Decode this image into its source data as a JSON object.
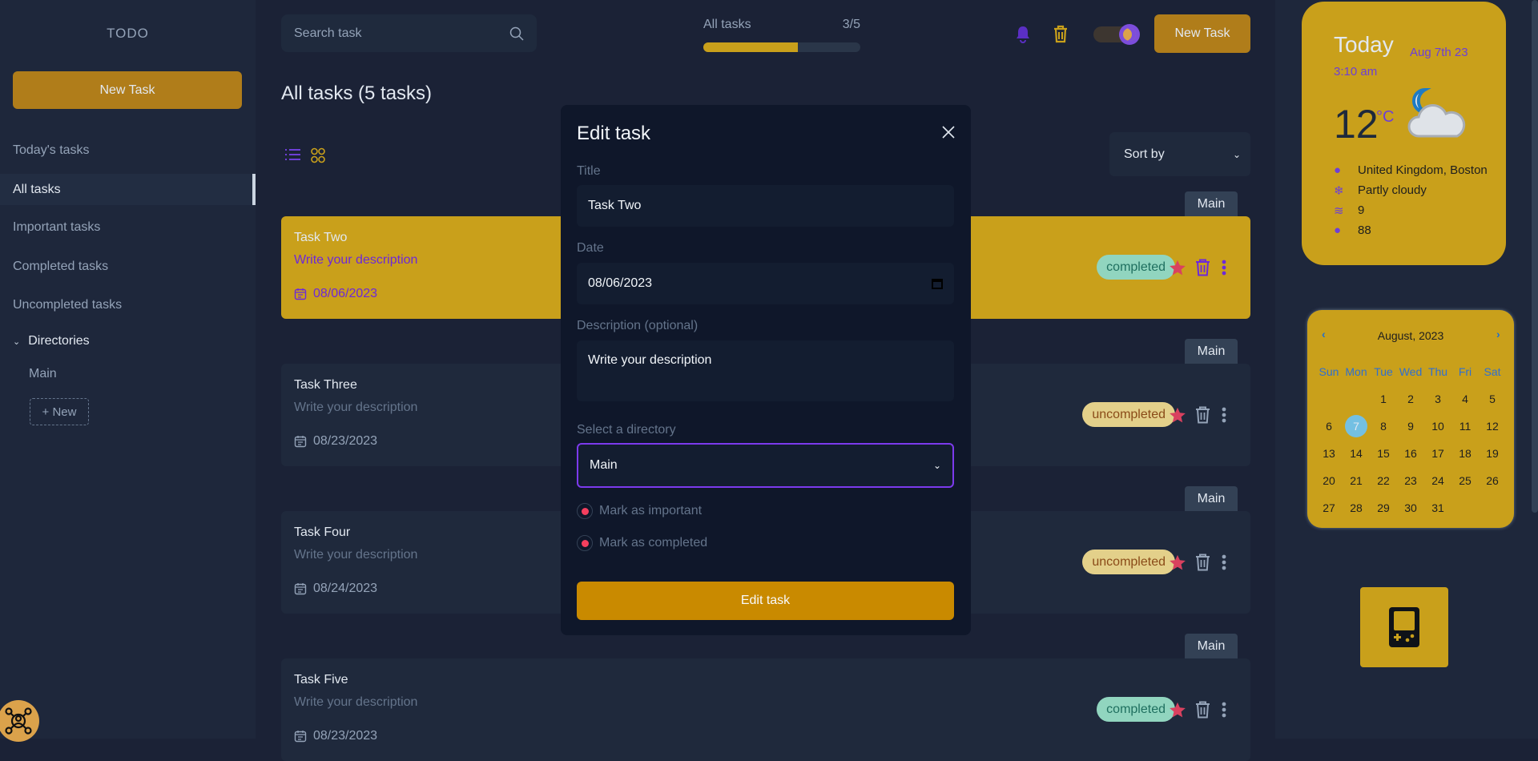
{
  "sidebar": {
    "app_title": "TODO",
    "new_task_label": "New Task",
    "items": [
      {
        "label": "Today's tasks"
      },
      {
        "label": "All tasks",
        "active": true
      },
      {
        "label": "Important tasks"
      },
      {
        "label": "Completed tasks"
      },
      {
        "label": "Uncompleted tasks"
      }
    ],
    "directories_label": "Directories",
    "directories": [
      {
        "label": "Main"
      }
    ],
    "new_directory_label": "+ New"
  },
  "header": {
    "search_placeholder": "Search task",
    "progress_label": "All tasks",
    "progress_count": "3/5",
    "progress_fraction": 0.6,
    "new_task_label": "New Task"
  },
  "main": {
    "page_title": "All tasks (5 tasks)",
    "sort_label": "Sort by",
    "tasks": [
      {
        "title": "Task Two",
        "description": "Write your description",
        "date": "08/06/2023",
        "status": "completed",
        "directory": "Main",
        "important": true,
        "highlighted": true
      },
      {
        "title": "Task Three",
        "description": "Write your description",
        "date": "08/23/2023",
        "status": "uncompleted",
        "directory": "Main",
        "important": true
      },
      {
        "title": "Task Four",
        "description": "Write your description",
        "date": "08/24/2023",
        "status": "uncompleted",
        "directory": "Main",
        "important": true
      },
      {
        "title": "Task Five",
        "description": "Write your description",
        "date": "08/23/2023",
        "status": "completed",
        "directory": "Main",
        "important": true
      }
    ]
  },
  "modal": {
    "title": "Edit task",
    "title_label": "Title",
    "title_value": "Task Two",
    "date_label": "Date",
    "date_value": "08/06/2023",
    "description_label": "Description (optional)",
    "description_value": "Write your description",
    "directory_label": "Select a directory",
    "directory_value": "Main",
    "important_label": "Mark as important",
    "completed_label": "Mark as completed",
    "submit_label": "Edit task"
  },
  "weather": {
    "heading": "Today",
    "date": "Aug 7th 23",
    "time": "3:10 am",
    "temperature": "12",
    "unit": "°C",
    "location": "United Kingdom, Boston",
    "condition": "Partly cloudy",
    "wind": "9",
    "humidity": "88"
  },
  "calendar": {
    "month_label": "August, 2023",
    "weekdays": [
      "Sun",
      "Mon",
      "Tue",
      "Wed",
      "Thu",
      "Fri",
      "Sat"
    ],
    "first_weekday": 2,
    "days": 31,
    "selected_day": 7
  },
  "colors": {
    "accent": "#c9a01b",
    "purple": "#6d28d9",
    "star": "#d9415f",
    "completed": "#91d5bf",
    "uncompleted": "#e3d08a"
  }
}
